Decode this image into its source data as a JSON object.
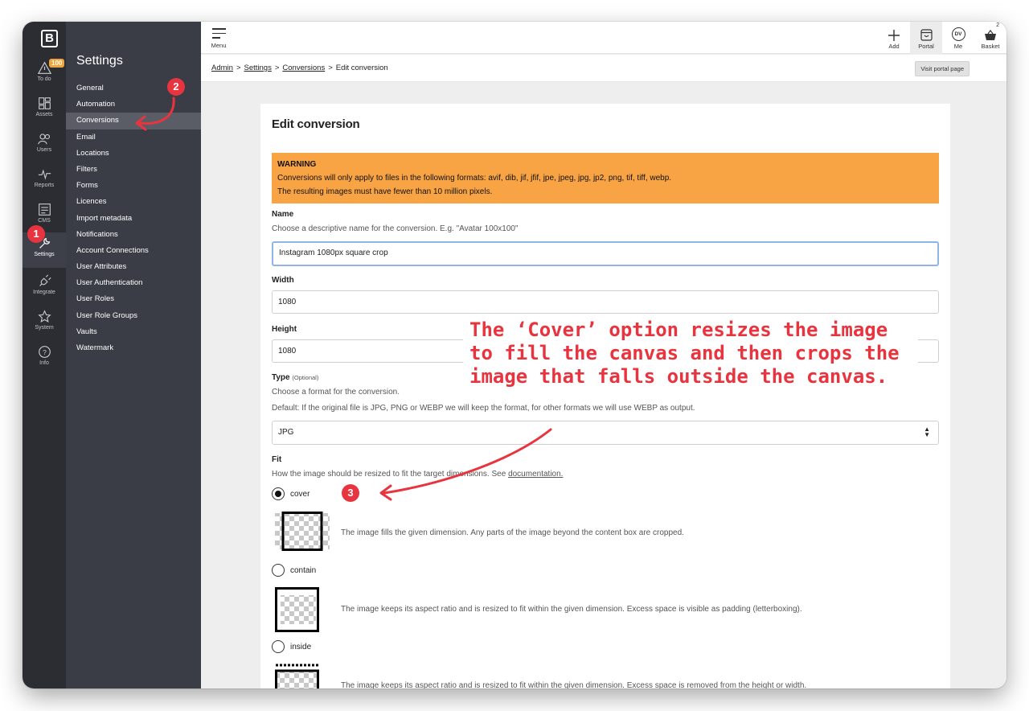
{
  "rail": {
    "items": [
      {
        "label": "To do",
        "badge": "100",
        "icon": "warning-icon"
      },
      {
        "label": "Assets",
        "icon": "assets-icon"
      },
      {
        "label": "Users",
        "icon": "users-icon"
      },
      {
        "label": "Reports",
        "icon": "reports-icon"
      },
      {
        "label": "CMS",
        "icon": "cms-icon"
      },
      {
        "label": "Settings",
        "icon": "wrench-icon",
        "active": true
      },
      {
        "label": "Integrate",
        "icon": "plug-icon"
      },
      {
        "label": "System",
        "icon": "star-icon"
      },
      {
        "label": "Info",
        "icon": "info-icon"
      }
    ]
  },
  "settings_panel": {
    "title": "Settings",
    "items": [
      "General",
      "Automation",
      "Conversions",
      "Email",
      "Locations",
      "Filters",
      "Forms",
      "Licences",
      "Import metadata",
      "Notifications",
      "Account Connections",
      "User Attributes",
      "User Authentication",
      "User Roles",
      "User Role Groups",
      "Vaults",
      "Watermark"
    ],
    "active_index": 2
  },
  "topbar": {
    "menu_label": "Menu",
    "actions": [
      {
        "label": "Add",
        "icon": "plus-icon"
      },
      {
        "label": "Portal",
        "icon": "portal-icon",
        "active": true
      },
      {
        "label": "Me",
        "icon": "avatar-icon",
        "initials": "DV"
      },
      {
        "label": "Basket",
        "icon": "basket-icon",
        "count": "2"
      }
    ]
  },
  "breadcrumb": {
    "items": [
      "Admin",
      "Settings",
      "Conversions"
    ],
    "current": "Edit conversion",
    "separator": ">"
  },
  "visit_portal_label": "Visit portal page",
  "form": {
    "title": "Edit conversion",
    "warning": {
      "heading": "WARNING",
      "line1": "Conversions will only apply to files in the following formats: avif, dib, jif, jfif, jpe, jpeg, jpg, jp2, png, tif, tiff, webp.",
      "line2": "The resulting images must have fewer than 10 million pixels."
    },
    "name": {
      "label": "Name",
      "help": "Choose a descriptive name for the conversion. E.g. \"Avatar 100x100\"",
      "value": "Instagram 1080px square crop"
    },
    "width": {
      "label": "Width",
      "value": "1080"
    },
    "height": {
      "label": "Height",
      "value": "1080"
    },
    "type": {
      "label": "Type",
      "optional": "(Optional)",
      "help1": "Choose a format for the conversion.",
      "help2": "Default: If the original file is JPG, PNG or WEBP we will keep the format, for other formats we will use WEBP as output.",
      "value": "JPG"
    },
    "fit": {
      "label": "Fit",
      "help": "How the image should be resized to fit the target dimensions. See",
      "link": "documentation.",
      "selected": "cover",
      "options": [
        {
          "value": "cover",
          "desc": "The image fills the given dimension. Any parts of the image beyond the content box are cropped."
        },
        {
          "value": "contain",
          "desc": "The image keeps its aspect ratio and is resized to fit within the given dimension. Excess space is visible as padding (letterboxing)."
        },
        {
          "value": "inside",
          "desc": "The image keeps its aspect ratio and is resized to fit within the given dimension. Excess space is removed from the height or width."
        }
      ]
    }
  },
  "annotations": {
    "callout": [
      "The ‘Cover’ option resizes the image",
      "to fill the canvas and then crops the",
      "image that falls outside the canvas."
    ],
    "badges": [
      "1",
      "2",
      "3"
    ],
    "color": "#e8343f"
  }
}
